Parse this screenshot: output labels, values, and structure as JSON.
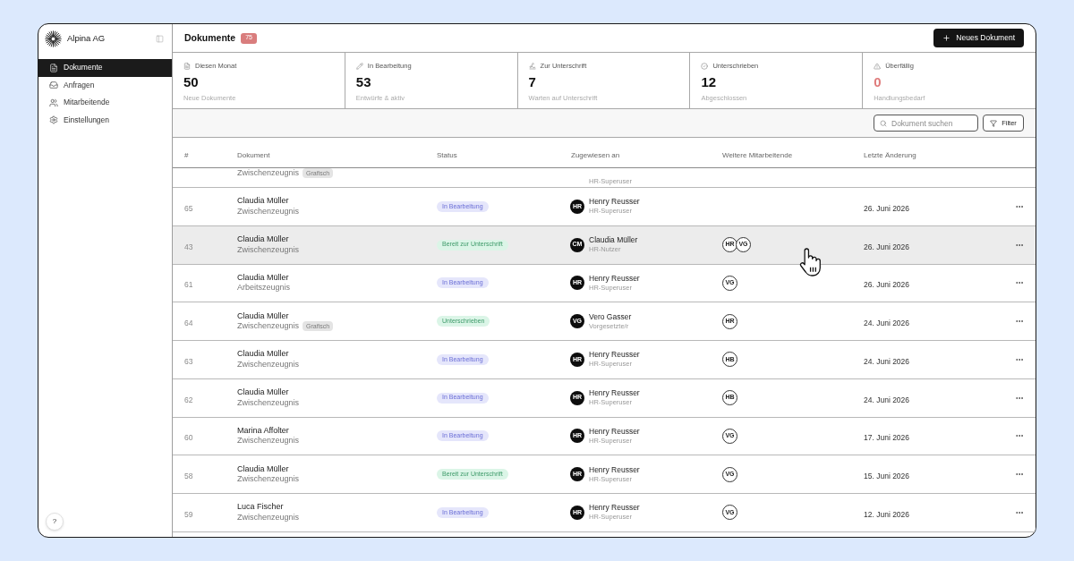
{
  "sidebar": {
    "brand": "Alpina AG",
    "nav": [
      {
        "label": "Dokumente",
        "selected": true
      },
      {
        "label": "Anfragen",
        "selected": false
      },
      {
        "label": "Mitarbeitende",
        "selected": false
      },
      {
        "label": "Einstellungen",
        "selected": false
      }
    ],
    "help": "?"
  },
  "header": {
    "title": "Dokumente",
    "count": "75",
    "button": "Neues Dokument"
  },
  "stats": [
    {
      "label": "Diesen Monat",
      "value": "50",
      "caption": "Neue Dokumente",
      "warning": false
    },
    {
      "label": "In Bearbeitung",
      "value": "53",
      "caption": "Entwürfe & aktiv",
      "warning": false
    },
    {
      "label": "Zur Unterschrift",
      "value": "7",
      "caption": "Warten auf Unterschrift",
      "warning": false
    },
    {
      "label": "Unterschrieben",
      "value": "12",
      "caption": "Abgeschlossen",
      "warning": false
    },
    {
      "label": "Überfällig",
      "value": "0",
      "caption": "Handlungsbedarf",
      "warning": true
    }
  ],
  "toolbar": {
    "search": {
      "placeholder": "Dokument suchen"
    },
    "filter": "Filter"
  },
  "table": {
    "columns": [
      "#",
      "Dokument",
      "Status",
      "Zugewiesen an",
      "Weitere Mitarbeitende",
      "Letzte Änderung"
    ],
    "partial_row": {
      "subtitle": "Zwischenzeugnis",
      "tag": "Grafisch",
      "assignee_role": "HR-Superuser"
    },
    "rows": [
      {
        "number": "65",
        "name": "Claudia Müller",
        "subtitle": "Zwischenzeugnis",
        "status": {
          "label": "In Bearbeitung",
          "kind": "in_progress"
        },
        "assignee": {
          "initials": "HR",
          "name": "Henry Reusser",
          "role": "HR-Superuser"
        },
        "date": "26. Juni 2026",
        "hovered": false
      },
      {
        "number": "43",
        "name": "Claudia Müller",
        "subtitle": "Zwischenzeugnis",
        "status": {
          "label": "Bereit zur Unterschrift",
          "kind": "ready"
        },
        "assignee": {
          "initials": "CM",
          "name": "Claudia Müller",
          "role": "HR-Nutzer"
        },
        "collaborators": [
          "HR",
          "VG"
        ],
        "date": "26. Juni 2026",
        "hovered": true
      },
      {
        "number": "61",
        "name": "Claudia Müller",
        "subtitle": "Arbeitszeugnis",
        "status": {
          "label": "In Bearbeitung",
          "kind": "in_progress"
        },
        "assignee": {
          "initials": "HR",
          "name": "Henry Reusser",
          "role": "HR-Superuser"
        },
        "collaborators": [
          "VG"
        ],
        "date": "26. Juni 2026",
        "hovered": false
      },
      {
        "number": "64",
        "name": "Claudia Müller",
        "subtitle": "Zwischenzeugnis",
        "tag": "Grafisch",
        "status": {
          "label": "Unterschrieben",
          "kind": "signed"
        },
        "assignee": {
          "initials": "VG",
          "name": "Vero Gasser",
          "role": "Vorgesetzte/r"
        },
        "collaborators": [
          "HR"
        ],
        "date": "24. Juni 2026",
        "hovered": false
      },
      {
        "number": "63",
        "name": "Claudia Müller",
        "subtitle": "Zwischenzeugnis",
        "status": {
          "label": "In Bearbeitung",
          "kind": "in_progress"
        },
        "assignee": {
          "initials": "HR",
          "name": "Henry Reusser",
          "role": "HR-Superuser"
        },
        "collaborators": [
          "HB"
        ],
        "date": "24. Juni 2026",
        "hovered": false
      },
      {
        "number": "62",
        "name": "Claudia Müller",
        "subtitle": "Zwischenzeugnis",
        "status": {
          "label": "In Bearbeitung",
          "kind": "in_progress"
        },
        "assignee": {
          "initials": "HR",
          "name": "Henry Reusser",
          "role": "HR-Superuser"
        },
        "collaborators": [
          "HB"
        ],
        "date": "24. Juni 2026",
        "hovered": false
      },
      {
        "number": "60",
        "name": "Marina Affolter",
        "subtitle": "Zwischenzeugnis",
        "status": {
          "label": "In Bearbeitung",
          "kind": "in_progress"
        },
        "assignee": {
          "initials": "HR",
          "name": "Henry Reusser",
          "role": "HR-Superuser"
        },
        "collaborators": [
          "VG"
        ],
        "date": "17. Juni 2026",
        "hovered": false
      },
      {
        "number": "58",
        "name": "Claudia Müller",
        "subtitle": "Zwischenzeugnis",
        "status": {
          "label": "Bereit zur Unterschrift",
          "kind": "ready"
        },
        "assignee": {
          "initials": "HR",
          "name": "Henry Reusser",
          "role": "HR-Superuser"
        },
        "collaborators": [
          "VG"
        ],
        "date": "15. Juni 2026",
        "hovered": false
      },
      {
        "number": "59",
        "name": "Luca Fischer",
        "subtitle": "Zwischenzeugnis",
        "status": {
          "label": "In Bearbeitung",
          "kind": "in_progress"
        },
        "assignee": {
          "initials": "HR",
          "name": "Henry Reusser",
          "role": "HR-Superuser"
        },
        "collaborators": [
          "VG"
        ],
        "date": "12. Juni 2026",
        "hovered": false
      }
    ]
  }
}
